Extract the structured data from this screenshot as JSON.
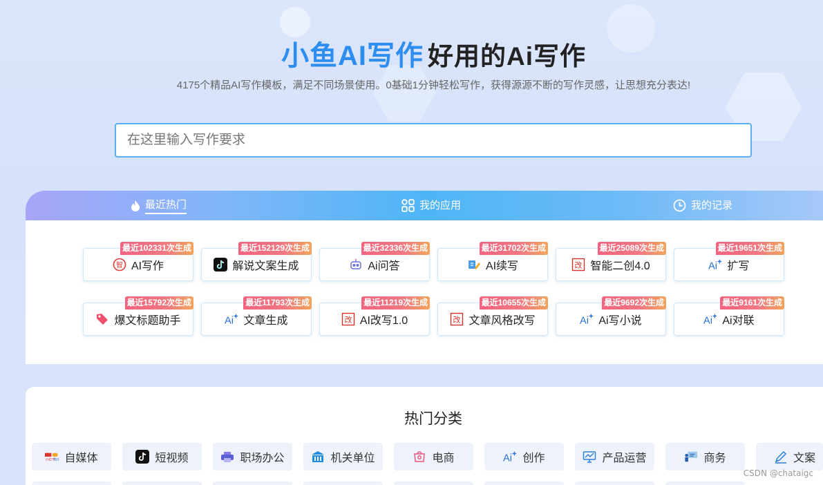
{
  "hero": {
    "brand": "小鱼AI写作",
    "slogan": "好用的Ai写作",
    "subtitle": "4175个精品AI写作模板，满足不同场景使用。0基础1分钟轻松写作，获得源源不断的写作灵感，让思想充分表达!"
  },
  "search": {
    "placeholder": "在这里输入写作要求"
  },
  "tabs": [
    {
      "label": "最近热门",
      "icon": "flame-icon"
    },
    {
      "label": "我的应用",
      "icon": "apps-grid-icon"
    },
    {
      "label": "我的记录",
      "icon": "clock-icon"
    }
  ],
  "hot_items": [
    {
      "label": "AI写作",
      "badge": "最近102331次生成",
      "icon": "zhi-icon"
    },
    {
      "label": "解说文案生成",
      "badge": "最近152129次生成",
      "icon": "tiktok-icon"
    },
    {
      "label": "Ai问答",
      "badge": "最近32336次生成",
      "icon": "robot-icon"
    },
    {
      "label": "AI续写",
      "badge": "最近31702次生成",
      "icon": "pen-icon"
    },
    {
      "label": "智能二创4.0",
      "badge": "最近25089次生成",
      "icon": "rewrite-icon"
    },
    {
      "label": "扩写",
      "badge": "最近19651次生成",
      "icon": "ai-sparkle-icon"
    },
    {
      "label": "爆文标题助手",
      "badge": "最近15792次生成",
      "icon": "tag-icon"
    },
    {
      "label": "文章生成",
      "badge": "最近11793次生成",
      "icon": "ai-sparkle-icon"
    },
    {
      "label": "AI改写1.0",
      "badge": "最近11219次生成",
      "icon": "rewrite-icon"
    },
    {
      "label": "文章风格改写",
      "badge": "最近10655次生成",
      "icon": "rewrite-icon"
    },
    {
      "label": "Ai写小说",
      "badge": "最近9692次生成",
      "icon": "ai-sparkle-icon"
    },
    {
      "label": "Ai对联",
      "badge": "最近9161次生成",
      "icon": "ai-sparkle-icon"
    }
  ],
  "categories": {
    "title": "热门分类",
    "items": [
      {
        "label": "自媒体",
        "icon": "media-logos-icon"
      },
      {
        "label": "短视频",
        "icon": "tiktok-icon"
      },
      {
        "label": "职场办公",
        "icon": "printer-icon"
      },
      {
        "label": "机关单位",
        "icon": "building-icon"
      },
      {
        "label": "电商",
        "icon": "shop-icon"
      },
      {
        "label": "创作",
        "icon": "ai-sparkle-icon"
      },
      {
        "label": "产品运营",
        "icon": "monitor-chart-icon"
      },
      {
        "label": "商务",
        "icon": "presentation-icon"
      },
      {
        "label": "文案",
        "icon": "pen-edit-icon"
      }
    ]
  },
  "watermark": "CSDN @chataigc",
  "colors": {
    "brand": "#2e8ef0",
    "badge": "#f2637f",
    "search_border": "#5aaef2"
  }
}
